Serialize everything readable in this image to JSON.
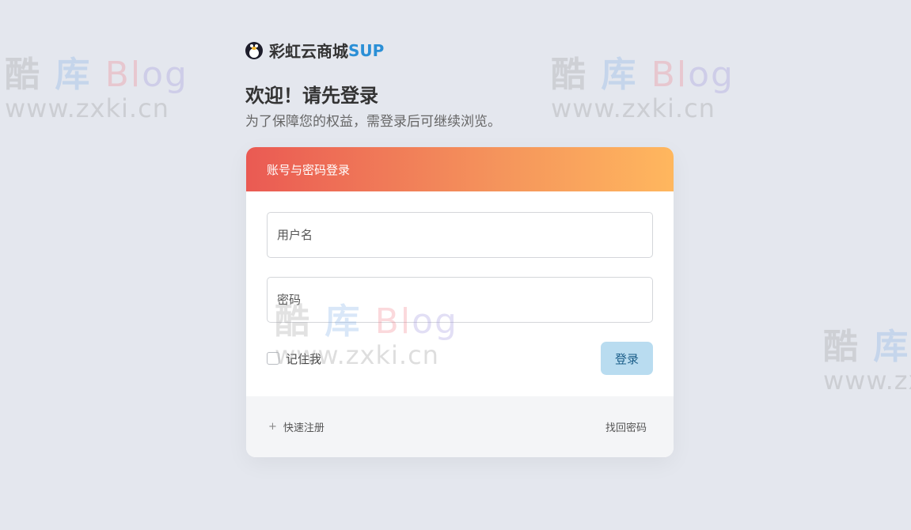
{
  "brand": {
    "name": "彩虹云商城",
    "suffix": "SUP",
    "logo_icon": "penguin-icon"
  },
  "header": {
    "welcome": "欢迎！请先登录",
    "subtitle": "为了保障您的权益，需登录后可继续浏览。"
  },
  "card": {
    "title": "账号与密码登录",
    "username": {
      "value": "",
      "placeholder": "用户名"
    },
    "password": {
      "value": "",
      "placeholder": "密码"
    },
    "remember_label": "记住我",
    "remember_checked": false,
    "login_label": "登录",
    "register_icon": "plus-icon",
    "register_label": "快速注册",
    "forgot_label": "找回密码"
  },
  "watermark": {
    "char1": "酷",
    "char2": "库",
    "char3": "Bl",
    "char4": "og",
    "url": "www.zxki.cn"
  },
  "colors": {
    "background": "#e4e7ee",
    "gradient_start": "#ea5a53",
    "gradient_end": "#ffb75e",
    "brand_accent": "#2a8fd6",
    "login_button": "#b9dcf0"
  }
}
